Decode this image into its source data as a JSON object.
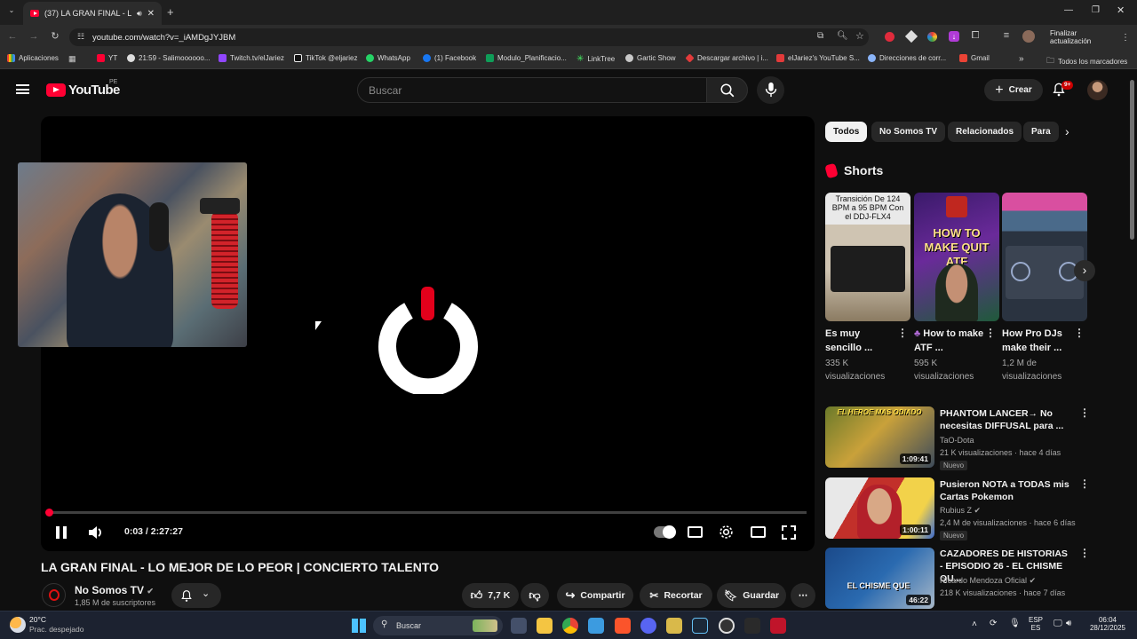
{
  "browser": {
    "tab_title": "(37) LA GRAN FINAL - LO M",
    "url": "youtube.com/watch?v=_iAMDgJYJBM",
    "update_label": "Finalizar actualización",
    "bookmarks": [
      {
        "label": "Aplicaciones",
        "icon": "grid-icon",
        "color": "#8ab4f8"
      },
      {
        "label": "YT",
        "icon": "youtube-icon",
        "color": "#ff0033"
      },
      {
        "label": "21:59 - Salimoooooo...",
        "icon": "clock-icon",
        "color": "#dddddd"
      },
      {
        "label": "Twitch.tv/elJariez",
        "icon": "twitch-icon",
        "color": "#9146ff"
      },
      {
        "label": "TikTok @eljariez",
        "icon": "tiktok-icon",
        "color": "#ffffff"
      },
      {
        "label": "WhatsApp",
        "icon": "whatsapp-icon",
        "color": "#25d366"
      },
      {
        "label": "(1) Facebook",
        "icon": "facebook-icon",
        "color": "#1877f2"
      },
      {
        "label": "Modulo_Planificacio...",
        "icon": "sheets-icon",
        "color": "#0f9d58"
      },
      {
        "label": "LinkTree",
        "icon": "linktree-icon",
        "color": "#43e660"
      },
      {
        "label": "Gartic Show",
        "icon": "gartic-icon",
        "color": "#c8c8c8"
      },
      {
        "label": "Descargar archivo | i...",
        "icon": "download-site-icon",
        "color": "#e33b3b"
      },
      {
        "label": "elJariez's YouTube S...",
        "icon": "stats-icon",
        "color": "#e23a3a"
      },
      {
        "label": "Direcciones de corr...",
        "icon": "globe-icon",
        "color": "#8ab4f8"
      },
      {
        "label": "Gmail",
        "icon": "gmail-icon",
        "color": "#ea4335"
      }
    ],
    "all_bookmarks": "Todos los marcadores"
  },
  "header": {
    "logo_text": "YouTube",
    "region": "PE",
    "search_placeholder": "Buscar",
    "create_label": "Crear",
    "notif_badge": "9+"
  },
  "player": {
    "time": "0:03 / 2:27:27",
    "progress": 0.001
  },
  "video": {
    "title": "LA GRAN FINAL - LO MEJOR DE LO PEOR | CONCIERTO TALENTO",
    "channel": "No Somos TV",
    "subscribers": "1,85 M de suscriptores",
    "likes": "7,7 K",
    "share": "Compartir",
    "clip": "Recortar",
    "save": "Guardar"
  },
  "sidebar": {
    "chips": [
      "Todos",
      "No Somos TV",
      "Relacionados",
      "Para"
    ],
    "shorts_title": "Shorts",
    "shorts": [
      {
        "title": "Es muy sencillo ...",
        "views": "335 K visualizaciones",
        "thumb_text": "Transición De 124 BPM a 95 BPM Con el DDJ-FLX4"
      },
      {
        "title": "How to make ATF ...",
        "views": "595 K visualizaciones",
        "thumb_text": "HOW TO MAKE QUIT ATF",
        "prefix": "♣"
      },
      {
        "title": "How Pro DJs make their ...",
        "views": "1,2 M de visualizaciones",
        "thumb_text": ""
      }
    ],
    "videos": [
      {
        "title": "PHANTOM LANCER→ No necesitas DIFFUSAL para ...",
        "channel": "TaO-Dota",
        "meta": "21 K visualizaciones · hace 4 días",
        "duration": "1:09:41",
        "badge": "Nuevo",
        "thumb_text": "EL HEROE MAS ODIADO",
        "verified": false
      },
      {
        "title": "Pusieron NOTA a TODAS mis Cartas Pokemon",
        "channel": "Rubius Z",
        "meta": "2,4 M de visualizaciones · hace 6 días",
        "duration": "1:00:11",
        "badge": "Nuevo",
        "thumb_text": "",
        "verified": true
      },
      {
        "title": "CAZADORES DE HISTORIAS - EPISODIO 26 - EL CHISME QU...",
        "channel": "Ricardo Mendoza Oficial",
        "meta": "218 K visualizaciones · hace 7 días",
        "duration": "46:22",
        "badge": "",
        "thumb_text": "EL CHISME QUE",
        "verified": true
      }
    ]
  },
  "taskbar": {
    "temp": "20°C",
    "weather": "Prac. despejado",
    "search": "Buscar",
    "lang1": "ESP",
    "lang2": "ES",
    "time": "06:04",
    "date": "28/12/2025"
  }
}
